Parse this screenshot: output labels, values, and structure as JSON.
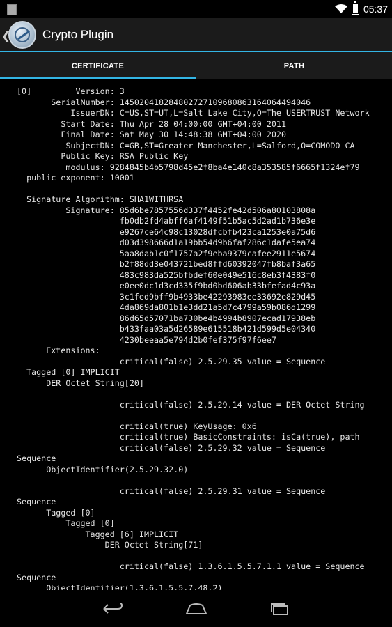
{
  "status_bar": {
    "time": "05:37"
  },
  "action_bar": {
    "title": "Crypto Plugin"
  },
  "tabs": [
    {
      "label": "CERTIFICATE",
      "selected": true
    },
    {
      "label": "PATH",
      "selected": false
    }
  ],
  "certificate_text": "[0]         Version: 3\n       SerialNumber: 145020418284802727109680863164064494046\n           IssuerDN: C=US,ST=UT,L=Salt Lake City,O=The USERTRUST Network\n         Start Date: Thu Apr 28 04:00:00 GMT+04:00 2011\n         Final Date: Sat May 30 14:48:38 GMT+04:00 2020\n          SubjectDN: C=GB,ST=Greater Manchester,L=Salford,O=COMODO CA\n         Public Key: RSA Public Key\n          modulus: 9284845b4b5798d45e2f8ba4e140c8a353585f6665f1324ef79\n  public exponent: 10001\n\n  Signature Algorithm: SHA1WITHRSA\n          Signature: 85d6be7857556d337f4452fe42d506a80103808a\n                     fb0db2fd4abff6af4149f51b5ac5d2ad1b736e3e\n                     e9267ce64c98c13028dfcbfb423ca1253e0a75d6\n                     d03d398666d1a19bb54d9b6faf286c1dafe5ea74\n                     5aa8dab1c0f1757a2f9eba9379cafee2911e5674\n                     b2f88dd3e043721bed8ffd60392047fb8baf3a65\n                     483c983da525bfbdef60e049e516c8eb3f4383f0\n                     e0ee0dc1d3cd335f9bd0bd606ab33bfefad4c93a\n                     3c1fed9bff9b4933be42293983ee33692e829d45\n                     4da869da801b1e3dd21a5d7c4799a59b086d1299\n                     86d65d57071ba730be4b4994b8907ecad17938eb\n                     b433faa03a5d26589e615518b421d599d5e04340\n                     4230beeaa5e794d2b0fef375f97f6ee7\n      Extensions:\n                     critical(false) 2.5.29.35 value = Sequence\n  Tagged [0] IMPLICIT\n      DER Octet String[20]\n\n                     critical(false) 2.5.29.14 value = DER Octet String\n\n                     critical(true) KeyUsage: 0x6\n                     critical(true) BasicConstraints: isCa(true), path\n                     critical(false) 2.5.29.32 value = Sequence\nSequence\n      ObjectIdentifier(2.5.29.32.0)\n\n                     critical(false) 2.5.29.31 value = Sequence\nSequence\n      Tagged [0]\n          Tagged [0]\n              Tagged [6] IMPLICIT\n                  DER Octet String[71]\n\n                     critical(false) 1.3.6.1.5.5.7.1.1 value = Sequence\nSequence\n      ObjectIdentifier(1.3.6.1.5.5.7.48.2)"
}
